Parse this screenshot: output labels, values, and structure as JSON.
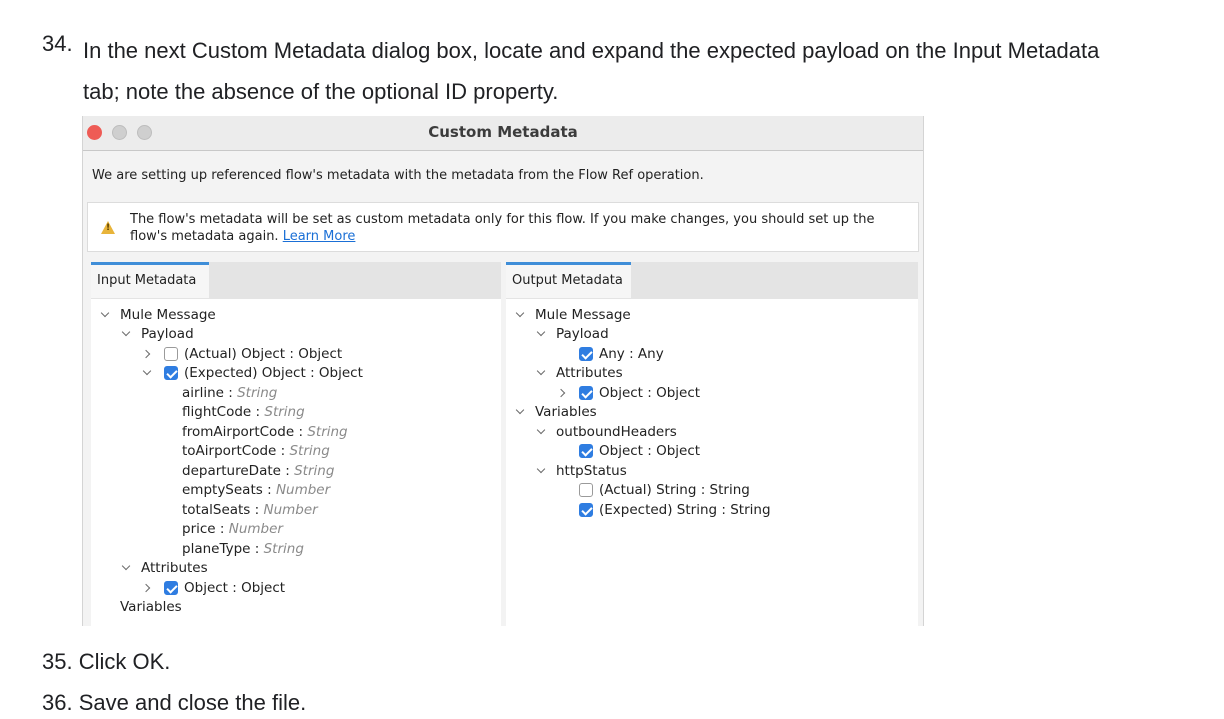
{
  "steps": {
    "s34_num": "34.",
    "s34_text": "In the next Custom Metadata dialog box, locate and expand the expected payload on the Input Metadata tab; note the absence of the optional ID property.",
    "s35_num": "35.",
    "s35_text": "Click OK.",
    "s36_num": "36.",
    "s36_text": "Save and close the file."
  },
  "dialog": {
    "title": "Custom Metadata",
    "intro": "We are setting up referenced flow's metadata with the metadata from the Flow Ref operation.",
    "notice_text": "The flow's metadata will be set as custom metadata only for this flow. If you make changes, you should set up the flow's metadata again.",
    "notice_link": "Learn More",
    "warning_glyph": "!"
  },
  "input": {
    "tab_label": "Input Metadata",
    "mule_message": "Mule Message",
    "payload": "Payload",
    "actual": "(Actual) Object : Object",
    "expected": "(Expected) Object : Object",
    "fields": [
      {
        "name": "airline",
        "type": "String"
      },
      {
        "name": "flightCode",
        "type": "String"
      },
      {
        "name": "fromAirportCode",
        "type": "String"
      },
      {
        "name": "toAirportCode",
        "type": "String"
      },
      {
        "name": "departureDate",
        "type": "String"
      },
      {
        "name": "emptySeats",
        "type": "Number"
      },
      {
        "name": "totalSeats",
        "type": "Number"
      },
      {
        "name": "price",
        "type": "Number"
      },
      {
        "name": "planeType",
        "type": "String"
      }
    ],
    "attributes": "Attributes",
    "attr_object": "Object : Object",
    "variables": "Variables"
  },
  "output": {
    "tab_label": "Output Metadata",
    "mule_message": "Mule Message",
    "payload": "Payload",
    "any": "Any : Any",
    "attributes": "Attributes",
    "attr_object": "Object : Object",
    "variables": "Variables",
    "outbound": "outboundHeaders",
    "outbound_object": "Object : Object",
    "http_status": "httpStatus",
    "actual_string": "(Actual) String : String",
    "expected_string": "(Expected) String : String"
  },
  "colors": {
    "accent": "#2f7de1",
    "close_button": "#ee5b55",
    "tab_indicator": "#3f8ed8",
    "warning": "#e8b43a",
    "link": "#1a6fd6"
  }
}
